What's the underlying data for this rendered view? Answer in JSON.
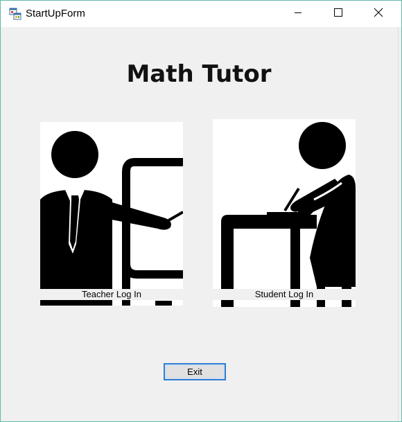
{
  "window": {
    "title": "StartUpForm",
    "controls": {
      "minimize_icon": "minimize-icon",
      "maximize_icon": "maximize-icon",
      "close_icon": "close-icon"
    }
  },
  "main": {
    "heading": "Math Tutor",
    "teacher": {
      "label": "Teacher Log In",
      "image_icon": "teacher-pictogram"
    },
    "student": {
      "label": "Student Log In",
      "image_icon": "student-pictogram"
    },
    "exit_label": "Exit"
  },
  "colors": {
    "window_border": "#5fb8a8",
    "button_focus_border": "#2c7dd6",
    "form_background": "#f0f0f0"
  }
}
